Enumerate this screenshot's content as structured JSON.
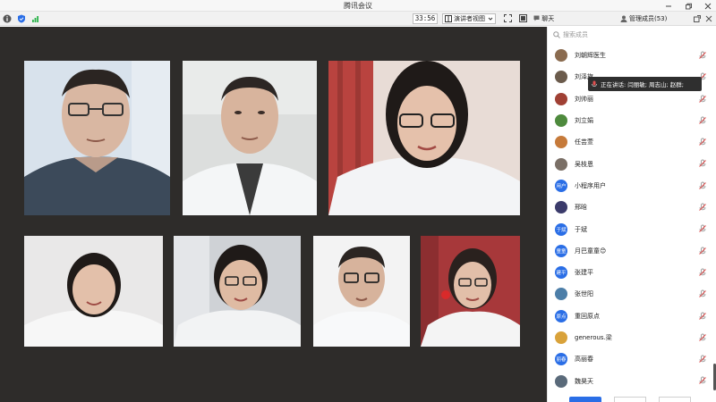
{
  "window": {
    "title": "腾讯会议"
  },
  "toolbar": {
    "timer": "33:56",
    "view_label": "演讲者视图",
    "tab_chat": "聊天",
    "tab_members": "管理成员(53)"
  },
  "search": {
    "placeholder": "搜索成员"
  },
  "members": [
    {
      "name": "刘朝辉医生",
      "avatar": ""
    },
    {
      "name": "刘泽旗",
      "avatar": ""
    },
    {
      "name": "刘帅丽",
      "avatar": ""
    },
    {
      "name": "刘立娟",
      "avatar": ""
    },
    {
      "name": "任芸萱",
      "avatar": ""
    },
    {
      "name": "吴枝恩",
      "avatar": ""
    },
    {
      "name": "小程序用户",
      "avatar": "用户"
    },
    {
      "name": "邢晗",
      "avatar": ""
    },
    {
      "name": "于斌",
      "avatar": "于斌"
    },
    {
      "name": "月巴童童😊",
      "avatar": "童童"
    },
    {
      "name": "张建平",
      "avatar": "建平"
    },
    {
      "name": "张世阳",
      "avatar": ""
    },
    {
      "name": "重回原点",
      "avatar": "原点"
    },
    {
      "name": "generous.梁",
      "avatar": ""
    },
    {
      "name": "高丽春",
      "avatar": "丽春"
    },
    {
      "name": "魏昊天",
      "avatar": ""
    }
  ],
  "tooltip": {
    "text": "正在讲话: 闫丽敏; 周志山; 赵群;"
  },
  "colors": {
    "accent": "#2a6ee6",
    "stage": "#2e2c2a",
    "mic_muted": "#e05050"
  }
}
